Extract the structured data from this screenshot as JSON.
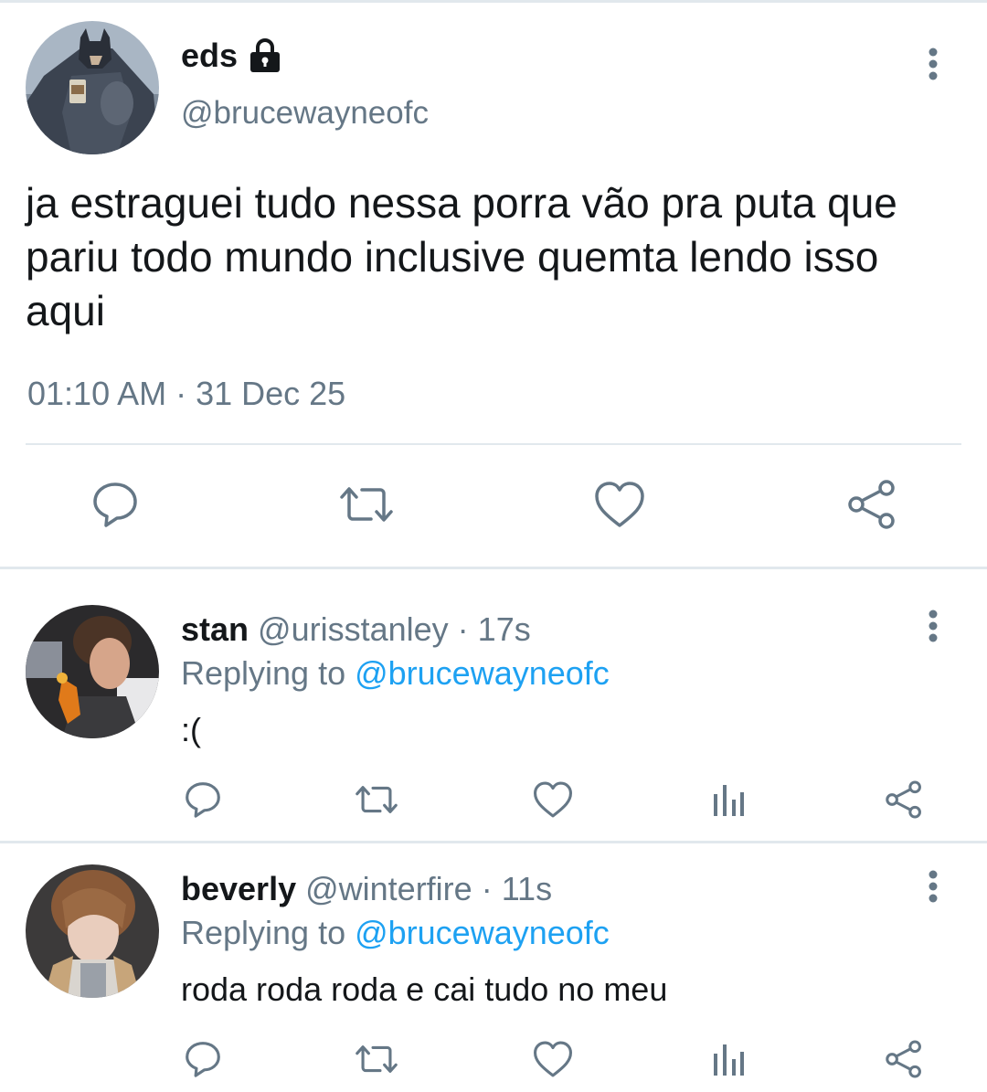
{
  "main_tweet": {
    "author_name": "eds",
    "author_handle": "@brucewayneofc",
    "text": "ja estraguei tudo nessa porra vão pra puta que\npariu todo mundo inclusive quemta lendo isso\naqui",
    "timestamp": "01:10 AM · 31 Dec 25",
    "icons": {
      "lock": "lock-icon",
      "more": "more-vertical-icon",
      "reply": "reply-icon",
      "retweet": "retweet-icon",
      "like": "heart-icon",
      "share": "share-icon"
    }
  },
  "replies": [
    {
      "name": "stan",
      "handle": "@urisstanley",
      "separator": " · ",
      "time": "17s",
      "replying_prefix": "Replying to ",
      "replying_to": "@brucewayneofc",
      "text": ":("
    },
    {
      "name": "beverly",
      "handle": "@winterfire",
      "separator": " · ",
      "time": "11s",
      "replying_prefix": "Replying to ",
      "replying_to": "@brucewayneofc",
      "text": "roda roda roda e cai tudo no meu"
    }
  ],
  "colors": {
    "text_primary": "#14171a",
    "text_secondary": "#657786",
    "accent": "#1da1f2",
    "divider": "#e1e8ed"
  }
}
